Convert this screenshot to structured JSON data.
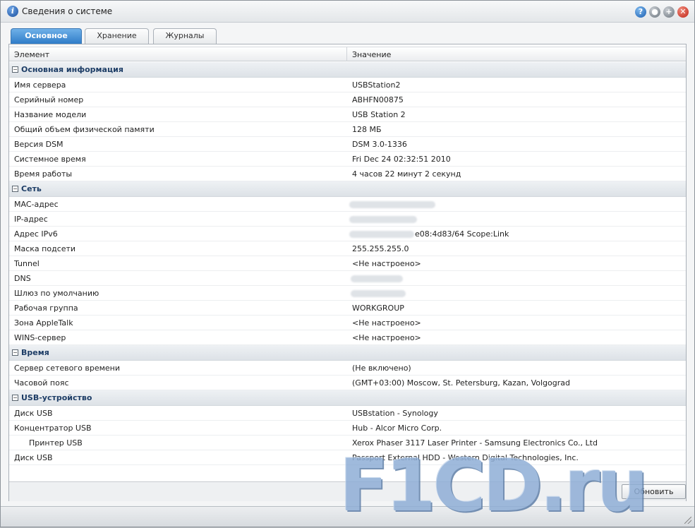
{
  "window": {
    "title": "Сведения о системе",
    "buttons": [
      "help-icon",
      "minimize-icon",
      "maximize-icon",
      "close-icon"
    ]
  },
  "tabs": [
    {
      "label": "Основное",
      "active": true
    },
    {
      "label": "Хранение",
      "active": false
    },
    {
      "label": "Журналы",
      "active": false
    }
  ],
  "grid": {
    "columns": [
      "Элемент",
      "Значение"
    ]
  },
  "groups": {
    "basic": {
      "label": "Основная информация",
      "rows": [
        {
          "name": "Имя сервера",
          "value": "USBStation2"
        },
        {
          "name": "Серийный номер",
          "value": "ABHFN00875"
        },
        {
          "name": "Название модели",
          "value": "USB Station 2"
        },
        {
          "name": "Общий объем физической памяти",
          "value": "128 МБ"
        },
        {
          "name": "Версия DSM",
          "value": "DSM 3.0-1336"
        },
        {
          "name": "Системное время",
          "value": "Fri Dec 24 02:32:51 2010"
        },
        {
          "name": "Время работы",
          "value": "4 часов 22 минут 2 секунд"
        }
      ]
    },
    "network": {
      "label": "Сеть",
      "rows": [
        {
          "name": "MAC-адрес",
          "value": ""
        },
        {
          "name": "IP-адрес",
          "value": ""
        },
        {
          "name": "Адрес IPv6",
          "value": "e08:4d83/64 Scope:Link"
        },
        {
          "name": "Маска подсети",
          "value": "255.255.255.0"
        },
        {
          "name": "Tunnel",
          "value": "<Не настроено>"
        },
        {
          "name": "DNS",
          "value": ""
        },
        {
          "name": "Шлюз по умолчанию",
          "value": ""
        },
        {
          "name": "Рабочая группа",
          "value": "WORKGROUP"
        },
        {
          "name": "Зона AppleTalk",
          "value": "<Не настроено>"
        },
        {
          "name": "WINS-сервер",
          "value": "<Не настроено>"
        }
      ]
    },
    "time": {
      "label": "Время",
      "rows": [
        {
          "name": "Сервер сетевого времени",
          "value": "(Не включено)"
        },
        {
          "name": "Часовой пояс",
          "value": "(GMT+03:00) Moscow, St. Petersburg, Kazan, Volgograd"
        }
      ]
    },
    "usb": {
      "label": "USB-устройство",
      "rows": [
        {
          "name": "Диск USB",
          "value": "USBstation - Synology"
        },
        {
          "name": "Концентратор USB",
          "value": "Hub - Alcor Micro Corp."
        },
        {
          "name": "Принтер USB",
          "value": "Xerox Phaser 3117 Laser Printer - Samsung Electronics Co., Ltd"
        },
        {
          "name": "Диск USB",
          "value": "Passport External HDD - Western Digital Technologies, Inc."
        }
      ]
    }
  },
  "footer": {
    "refresh_label": "Обновить"
  },
  "watermark": "F1CD.ru"
}
